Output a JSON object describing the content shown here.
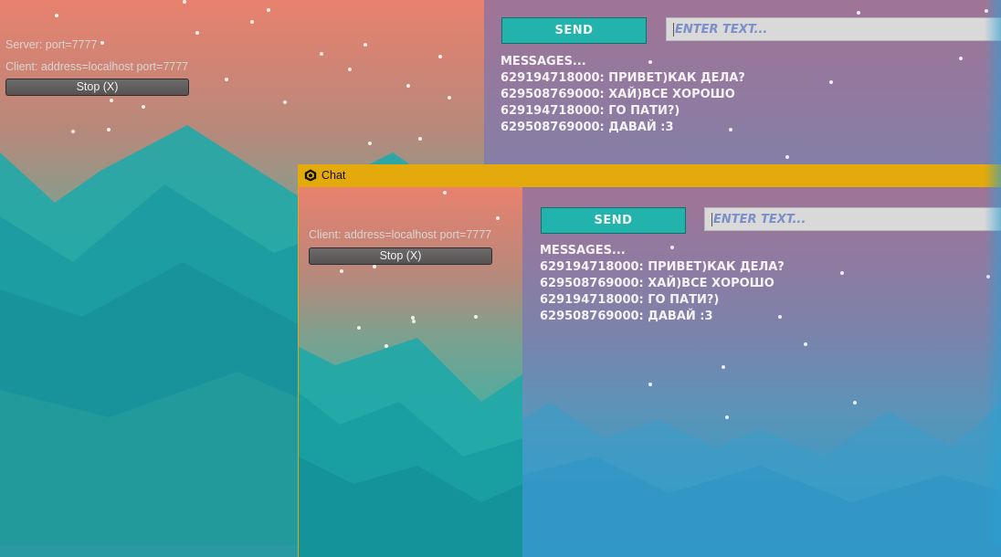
{
  "server_window": {
    "server_status": "Server: port=7777",
    "client_status": "Client: address=localhost port=7777",
    "stop_label": "Stop (X)",
    "send_label": "SEND",
    "input_placeholder": "ENTER TEXT...",
    "messages_header": "MESSAGES...",
    "messages": [
      "629194718000: ПРИВЕТ)КАК ДЕЛА?",
      "629508769000: ХАЙ)ВСЕ ХОРОШО",
      "629194718000: ГО ПАТИ?)",
      "629508769000: ДАВАЙ :3"
    ]
  },
  "chat_window": {
    "title": "Chat",
    "client_status": "Client: address=localhost port=7777",
    "stop_label": "Stop (X)",
    "send_label": "SEND",
    "input_placeholder": "ENTER TEXT...",
    "messages_header": "MESSAGES...",
    "messages": [
      "629194718000: ПРИВЕТ)КАК ДЕЛА?",
      "629508769000: ХАЙ)ВСЕ ХОРОШО",
      "629194718000: ГО ПАТИ?)",
      "629508769000: ДАВАЙ :3"
    ]
  },
  "colors": {
    "titlebar": "#e4a90a",
    "send_button": "#22b4ac",
    "input_background": "#d9d9d9",
    "placeholder_text": "#7b8ec8"
  },
  "icons": {
    "app_icon": "unity-logo-icon"
  }
}
